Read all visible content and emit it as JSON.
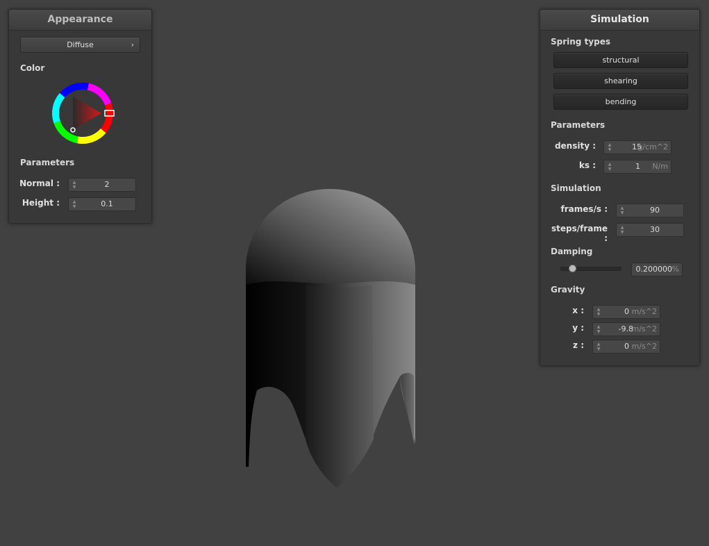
{
  "appearance": {
    "title": "Appearance",
    "shader": "Diffuse",
    "color_label": "Color",
    "params_label": "Parameters",
    "normal_label": "Normal :",
    "normal_value": "2",
    "height_label": "Height :",
    "height_value": "0.1",
    "chevron_icon": "chevron-right-icon",
    "wheel_icon": "color-wheel-icon"
  },
  "simulation": {
    "title": "Simulation",
    "spring_label": "Spring types",
    "springs": [
      "structural",
      "shearing",
      "bending"
    ],
    "params_label": "Parameters",
    "density_label": "density :",
    "density_value": "15",
    "density_unit": "g/cm^2",
    "ks_label": "ks :",
    "ks_value": "1",
    "ks_unit": "N/m",
    "sim_label": "Simulation",
    "fps_label": "frames/s :",
    "fps_value": "90",
    "steps_label": "steps/frame :",
    "steps_value": "30",
    "damping_label": "Damping",
    "damping_value": "0.200000",
    "damping_unit": "%",
    "damping_level": 0.2,
    "gravity_label": "Gravity",
    "gx_label": "x :",
    "gx_value": "0",
    "gy_label": "y :",
    "gy_value": "-9.8",
    "gz_label": "z :",
    "gz_value": "0",
    "gravity_unit": "m/s^2"
  },
  "colors": {
    "background": "#414141",
    "panel": "#383838",
    "selected_color": "#cc2222"
  }
}
